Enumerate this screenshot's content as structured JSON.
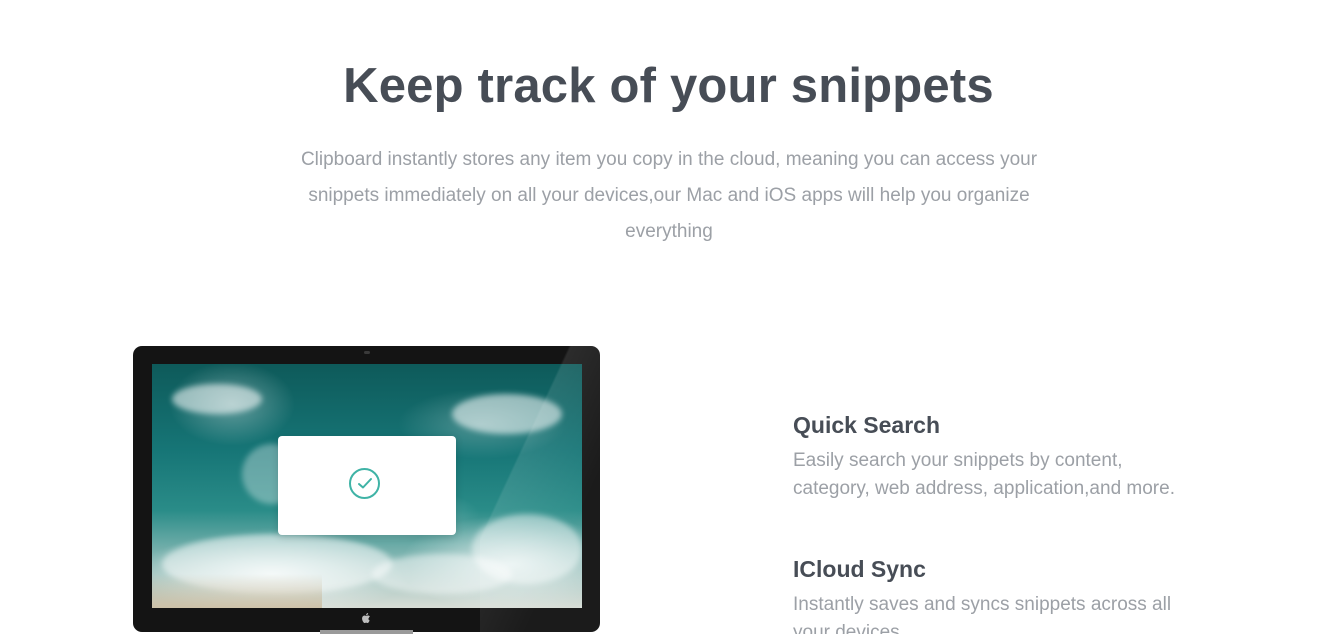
{
  "hero": {
    "title": "Keep track of your snippets",
    "description": "Clipboard instantly stores any item you copy in the cloud, meaning you can access your snippets immediately on all your devices,our Mac and iOS apps will help you organize everything"
  },
  "monitor": {
    "screen_icon": "check-circle-icon",
    "brand_icon": "apple-logo-icon"
  },
  "features": [
    {
      "title": "Quick Search",
      "description": "Easily search your snippets by content, category, web address, application,and more."
    },
    {
      "title": "ICloud Sync",
      "description": "Instantly saves and syncs snippets across all your devices."
    }
  ],
  "colors": {
    "heading": "#474d56",
    "body_text": "#9ca0a6",
    "accent": "#3fb3a6",
    "monitor_bezel": "#141414"
  }
}
